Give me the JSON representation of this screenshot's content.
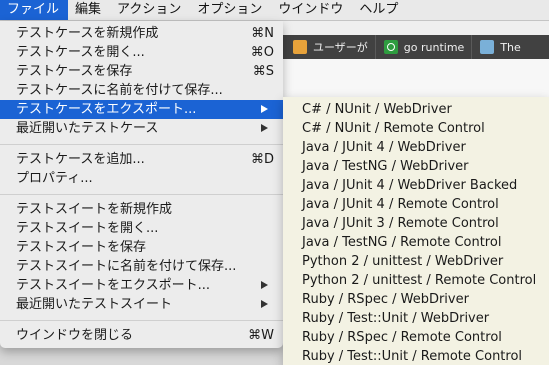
{
  "menubar": {
    "items": [
      "ファイル",
      "編集",
      "アクション",
      "オプション",
      "ウインドウ",
      "ヘルプ"
    ]
  },
  "bookmarks": [
    {
      "label": "ユーザーが",
      "icon": "package-icon"
    },
    {
      "label": "go runtime",
      "icon": "go-icon"
    },
    {
      "label": "The",
      "icon": "site-icon"
    }
  ],
  "file_menu": {
    "new_test_case": {
      "label": "テストケースを新規作成",
      "shortcut": "⌘N"
    },
    "open_test_case": {
      "label": "テストケースを開く...",
      "shortcut": "⌘O"
    },
    "save_test_case": {
      "label": "テストケースを保存",
      "shortcut": "⌘S"
    },
    "save_test_case_as": {
      "label": "テストケースに名前を付けて保存..."
    },
    "export_test_case": {
      "label": "テストケースをエクスポート..."
    },
    "recent_test_cases": {
      "label": "最近開いたテストケース"
    },
    "add_test_case": {
      "label": "テストケースを追加...",
      "shortcut": "⌘D"
    },
    "properties": {
      "label": "プロパティ..."
    },
    "new_test_suite": {
      "label": "テストスイートを新規作成"
    },
    "open_test_suite": {
      "label": "テストスイートを開く..."
    },
    "save_test_suite": {
      "label": "テストスイートを保存"
    },
    "save_test_suite_as": {
      "label": "テストスイートに名前を付けて保存..."
    },
    "export_test_suite": {
      "label": "テストスイートをエクスポート..."
    },
    "recent_test_suites": {
      "label": "最近開いたテストスイート"
    },
    "close_window": {
      "label": "ウインドウを閉じる",
      "shortcut": "⌘W"
    }
  },
  "export_submenu": [
    "C# / NUnit / WebDriver",
    "C# / NUnit / Remote Control",
    "Java / JUnit 4 / WebDriver",
    "Java / TestNG / WebDriver",
    "Java / JUnit 4 / WebDriver Backed",
    "Java / JUnit 4 / Remote Control",
    "Java / JUnit 3 / Remote Control",
    "Java / TestNG / Remote Control",
    "Python 2 / unittest / WebDriver",
    "Python 2 / unittest / Remote Control",
    "Ruby / RSpec / WebDriver",
    "Ruby / Test::Unit / WebDriver",
    "Ruby / RSpec / Remote Control",
    "Ruby / Test::Unit / Remote Control"
  ],
  "colors": {
    "highlight": "#1b63d4",
    "menu_bg": "#ececec",
    "submenu_bg": "#f3f2e3"
  }
}
